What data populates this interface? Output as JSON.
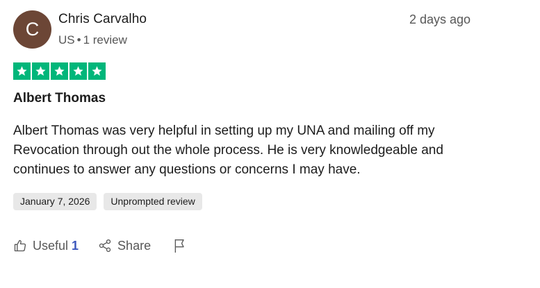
{
  "reviewer": {
    "initial": "C",
    "name": "Chris Carvalho",
    "country": "US",
    "separator": "•",
    "review_count": "1 review",
    "avatar_color": "#6c4636"
  },
  "review": {
    "time_ago": "2 days ago",
    "rating": 5,
    "star_color": "#00b67a",
    "title": "Albert Thomas",
    "body": "Albert Thomas was very helpful in setting up my UNA and mailing off my Revocation through out the whole process. He is very knowledgeable and continues to answer any questions or concerns I may have.",
    "date_tag": "January 7, 2026",
    "unprompted_tag": "Unprompted review"
  },
  "actions": {
    "useful_label": "Useful",
    "useful_count": "1",
    "share_label": "Share",
    "useful_icon": "thumbs-up-icon",
    "share_icon": "share-icon",
    "report_icon": "flag-icon"
  }
}
